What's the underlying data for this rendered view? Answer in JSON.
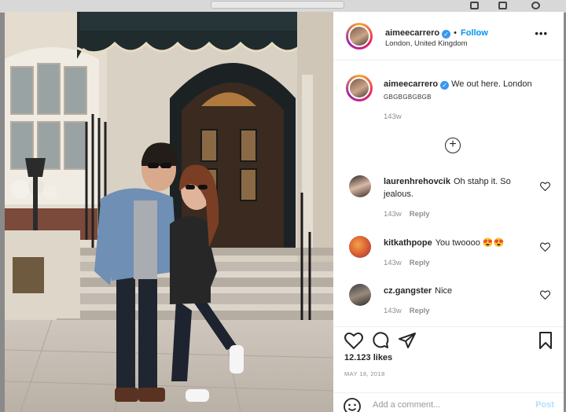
{
  "post": {
    "username": "aimeecarrero",
    "follow_label": "Follow",
    "location": "London, United Kingdom",
    "more_label": "•••",
    "caption_text": "We out here. London",
    "caption_tag": "GBGBGBGBGB",
    "caption_time": "143w",
    "likes": "12.123 likes",
    "date": "MAY 18, 2018",
    "add_comment_placeholder": "Add a comment...",
    "post_label": "Post",
    "load_more": "+"
  },
  "comments": [
    {
      "username": "laurenhrehovcik",
      "text": "Oh stahp it. So jealous.",
      "time": "143w",
      "reply": "Reply"
    },
    {
      "username": "kitkathpope",
      "text": "You twoooo 😍😍",
      "time": "143w",
      "reply": "Reply"
    },
    {
      "username": "cz.gangster",
      "text": "Nice",
      "time": "143w",
      "reply": "Reply"
    }
  ],
  "colors": {
    "accent": "#0095f6",
    "verified": "#3897f0",
    "text": "#262626",
    "muted": "#8e8e8e"
  }
}
